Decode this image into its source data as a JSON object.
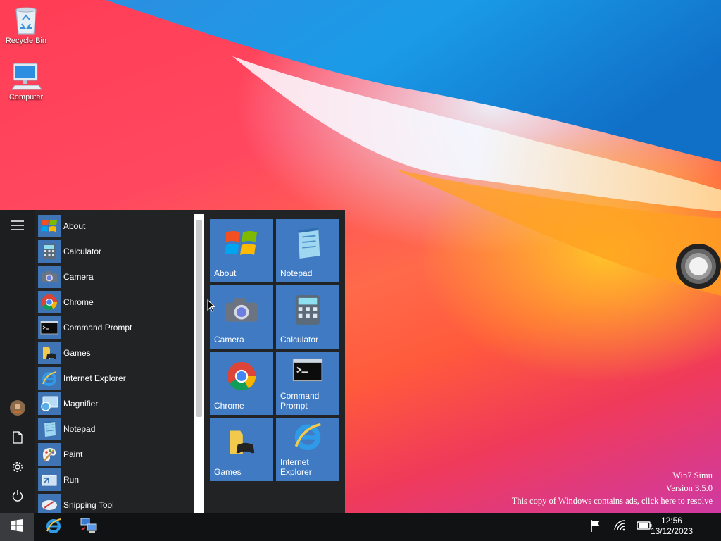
{
  "desktop": {
    "icons": [
      {
        "label": "Recycle Bin",
        "icon": "recycle-bin-icon"
      },
      {
        "label": "Computer",
        "icon": "computer-icon"
      }
    ],
    "watermark": {
      "line1": "Win7 Simu",
      "line2": "Version 3.5.0",
      "line3": "This copy of Windows contains ads, click here to resolve"
    }
  },
  "start_menu": {
    "rail": {
      "menu_icon": "hamburger-icon",
      "user_icon": "user-avatar-icon",
      "documents_icon": "document-icon",
      "settings_icon": "gear-icon",
      "power_icon": "power-icon"
    },
    "apps": [
      {
        "label": "About",
        "icon": "windows-flag-icon"
      },
      {
        "label": "Calculator",
        "icon": "calculator-icon"
      },
      {
        "label": "Camera",
        "icon": "camera-icon"
      },
      {
        "label": "Chrome",
        "icon": "chrome-icon"
      },
      {
        "label": "Command Prompt",
        "icon": "command-prompt-icon"
      },
      {
        "label": "Games",
        "icon": "games-icon"
      },
      {
        "label": "Internet Explorer",
        "icon": "internet-explorer-icon"
      },
      {
        "label": "Magnifier",
        "icon": "magnifier-icon"
      },
      {
        "label": "Notepad",
        "icon": "notepad-icon"
      },
      {
        "label": "Paint",
        "icon": "paint-icon"
      },
      {
        "label": "Run",
        "icon": "run-icon"
      },
      {
        "label": "Snipping Tool",
        "icon": "snipping-tool-icon"
      }
    ],
    "tiles": [
      {
        "label": "About",
        "icon": "windows-flag-icon"
      },
      {
        "label": "Notepad",
        "icon": "notepad-icon"
      },
      {
        "label": "Camera",
        "icon": "camera-icon"
      },
      {
        "label": "Calculator",
        "icon": "calculator-icon"
      },
      {
        "label": "Chrome",
        "icon": "chrome-icon"
      },
      {
        "label": "Command Prompt",
        "icon": "command-prompt-icon"
      },
      {
        "label": "Games",
        "icon": "games-icon"
      },
      {
        "label": "Internet Explorer",
        "icon": "internet-explorer-icon"
      }
    ]
  },
  "taskbar": {
    "start_icon": "windows-start-icon",
    "pinned": [
      {
        "icon": "internet-explorer-icon"
      },
      {
        "icon": "network-computers-icon"
      }
    ],
    "tray": {
      "flag_icon": "action-center-flag-icon",
      "wifi_icon": "wifi-icon",
      "battery_icon": "battery-icon"
    },
    "clock": {
      "time": "12:56",
      "date": "13/12/2023"
    }
  },
  "colors": {
    "accent_tile": "#3f7ac2",
    "menu_bg": "#222324",
    "taskbar_bg": "#111214"
  }
}
